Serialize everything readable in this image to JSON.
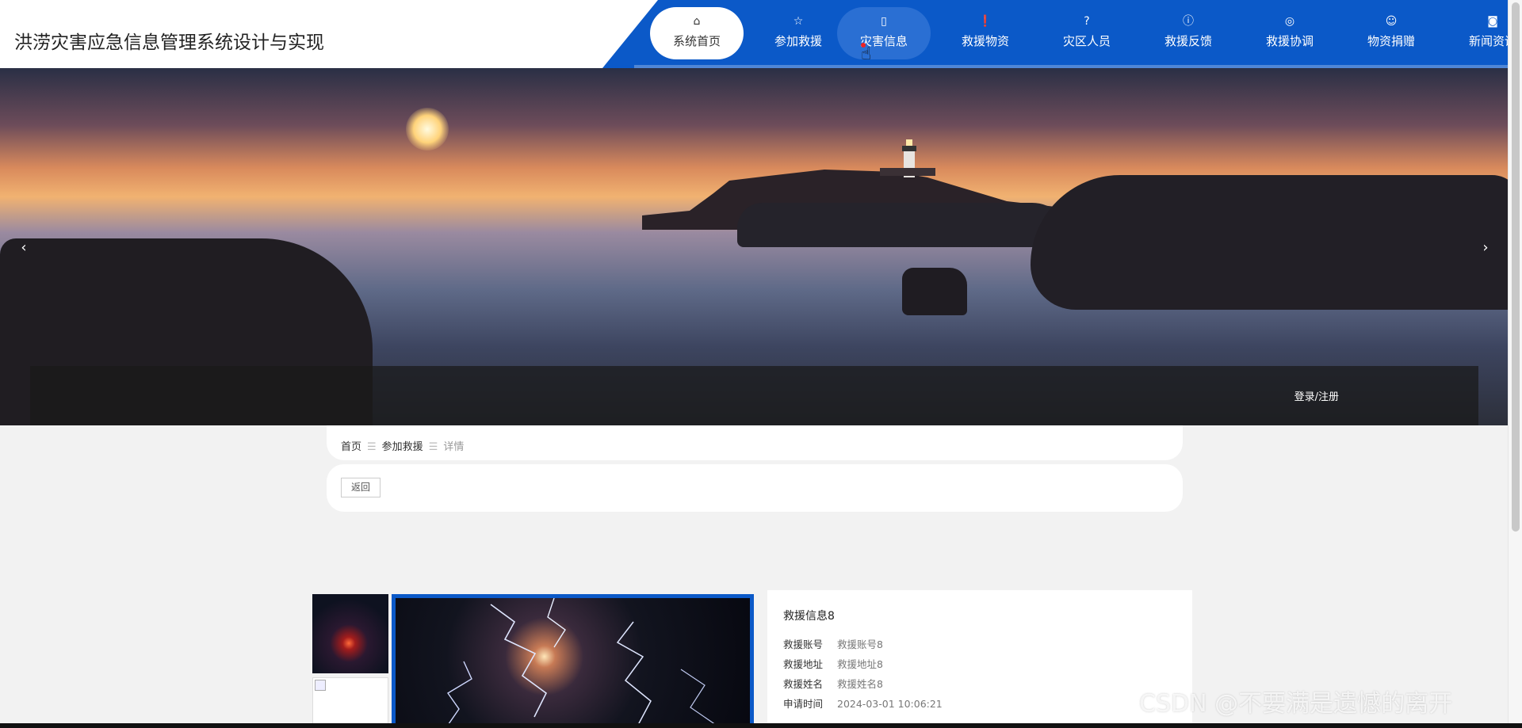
{
  "site": {
    "title": "洪涝灾害应急信息管理系统设计与实现"
  },
  "nav": {
    "items": [
      {
        "label": "系统首页",
        "icon": "home-icon",
        "glyph": "⌂"
      },
      {
        "label": "参加救援",
        "icon": "star-icon",
        "glyph": "☆"
      },
      {
        "label": "灾害信息",
        "icon": "bag-icon",
        "glyph": "▯"
      },
      {
        "label": "救援物资",
        "icon": "alert-icon",
        "glyph": "❗"
      },
      {
        "label": "灾区人员",
        "icon": "help-icon",
        "glyph": "?"
      },
      {
        "label": "救援反馈",
        "icon": "info-icon",
        "glyph": "ⓘ"
      },
      {
        "label": "救援协调",
        "icon": "sync-icon",
        "glyph": "◎"
      },
      {
        "label": "物资捐赠",
        "icon": "check-circle-icon",
        "glyph": "☺"
      },
      {
        "label": "新闻资讯",
        "icon": "camera-icon",
        "glyph": "◙"
      }
    ],
    "active_index": 0,
    "hover_index": 2,
    "colors": {
      "bar": "#0b59c8",
      "active_bg": "#ffffff"
    }
  },
  "banner": {
    "prev_glyph": "‹",
    "next_glyph": "›",
    "login_label": "登录/注册"
  },
  "breadcrumb": {
    "home": "首页",
    "section": "参加救援",
    "current": "详情",
    "separator": "☰"
  },
  "back_button": {
    "label": "返回"
  },
  "detail": {
    "title": "救援信息8",
    "fields": [
      {
        "key": "救援账号",
        "value": "救援账号8"
      },
      {
        "key": "救援地址",
        "value": "救援地址8"
      },
      {
        "key": "救援姓名",
        "value": "救援姓名8"
      },
      {
        "key": "申请时间",
        "value": "2024-03-01 10:06:21"
      }
    ]
  },
  "watermark": "CSDN @不要满是遗憾的离开"
}
